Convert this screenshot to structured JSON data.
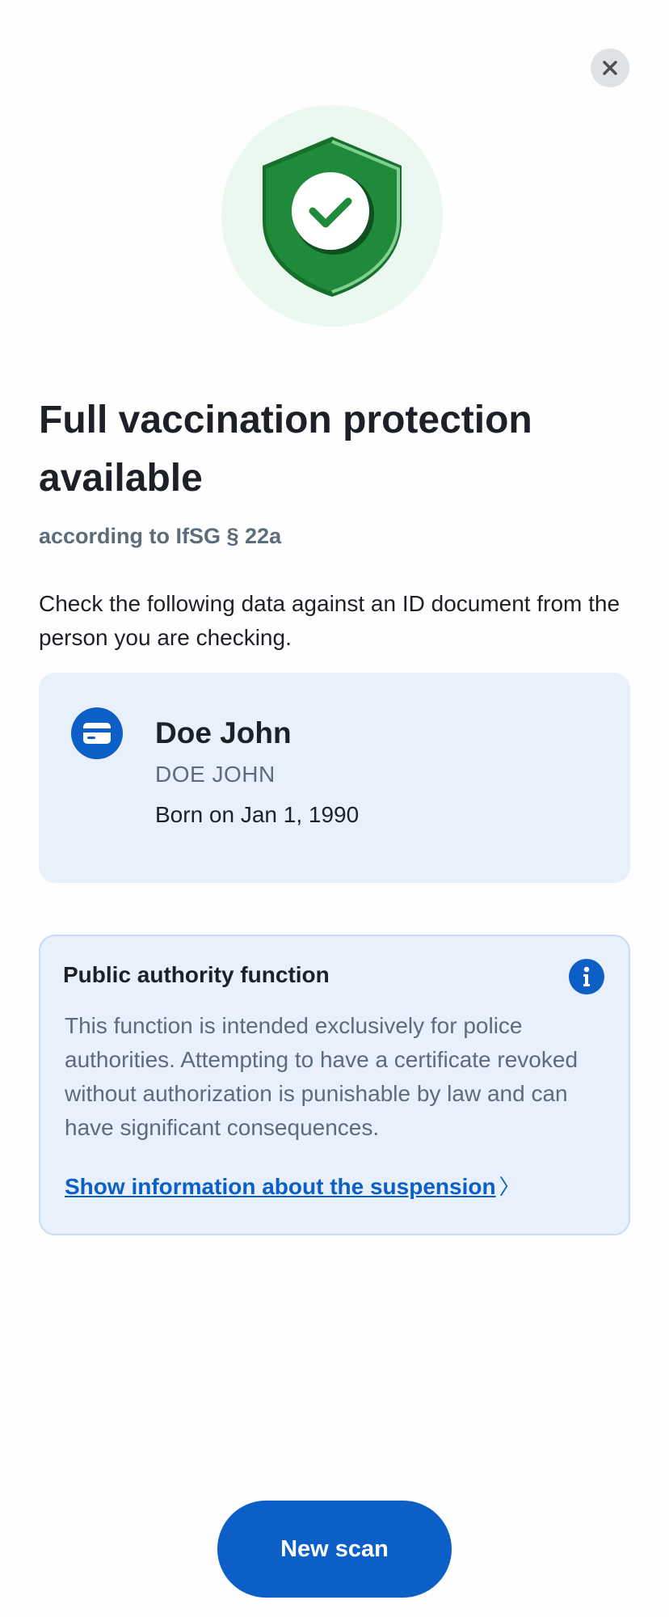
{
  "header": {
    "close_icon": "close-icon"
  },
  "hero": {
    "icon": "shield-check-icon",
    "colors": {
      "circle_bg": "#ebf8ef",
      "shield": "#1e8a3a",
      "check": "#1e8a3a"
    }
  },
  "result": {
    "title": "Full vaccination protection available",
    "subtitle": "according to IfSG § 22a",
    "instruction": "Check the following data against an ID document from the person you are checking."
  },
  "person": {
    "icon": "id-card-icon",
    "name": "Doe John",
    "name_standardized": "DOE JOHN",
    "birth_date": "Born on Jan 1, 1990"
  },
  "authority": {
    "title": "Public authority function",
    "icon": "info-icon",
    "text": "This function is intended exclusively for police authorities. Attempting to have a certificate revoked without authorization is punishable by law and can have significant consequences.",
    "link_label": "Show information about the suspension",
    "link_chevron": "〉"
  },
  "footer": {
    "new_scan_label": "New scan"
  },
  "theme": {
    "accent": "#0b5fc6",
    "text_primary": "#1d2127",
    "text_secondary": "#5b6c7b",
    "card_bg": "#e8f0fc"
  }
}
